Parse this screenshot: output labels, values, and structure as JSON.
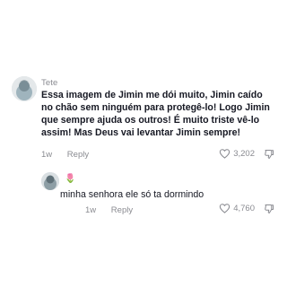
{
  "comments": [
    {
      "username": "Tete",
      "lines": [
        "Essa imagem de Jimin me dói muito, Jimin caído",
        "no chão sem ninguém para protegê-lo! Logo Jimin",
        "que sempre ajuda os outros! É muito triste vê-lo",
        "assim! Mas Deus vai levantar Jimin sempre!"
      ],
      "time": "1w",
      "reply_label": "Reply",
      "like_count": "3,202",
      "icons": {
        "like": "heart-outline-icon",
        "dislike": "thumbs-down-outline-icon"
      }
    }
  ],
  "replies": [
    {
      "username": "🌷",
      "text": "minha senhora ele só ta dormindo",
      "time": "1w",
      "reply_label": "Reply",
      "like_count": "4,760",
      "icons": {
        "like": "heart-outline-icon",
        "dislike": "thumbs-down-outline-icon"
      }
    }
  ],
  "colors": {
    "text": "#161823",
    "muted": "#8a8b91",
    "background": "#ffffff"
  }
}
